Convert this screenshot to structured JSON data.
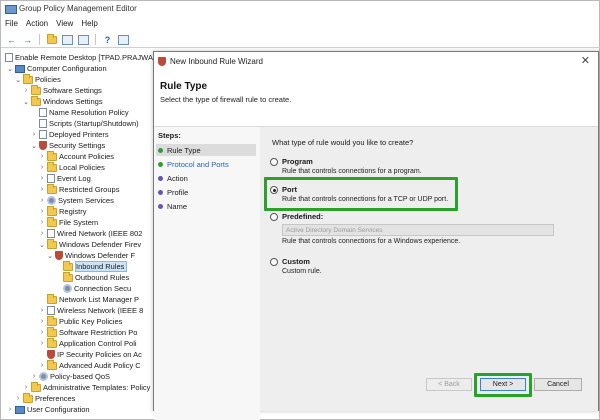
{
  "window": {
    "title": "Group Policy Management Editor"
  },
  "menu": [
    "File",
    "Action",
    "View",
    "Help"
  ],
  "tree": [
    {
      "label": "Enable Remote Desktop [TPAD.PRAJWALLO",
      "icon": "policy-document-icon"
    },
    {
      "label": "Computer Configuration",
      "icon": "computer-icon"
    },
    {
      "label": "Policies",
      "icon": "folder-icon"
    },
    {
      "label": "Software Settings",
      "icon": "folder-icon"
    },
    {
      "label": "Windows Settings",
      "icon": "folder-icon"
    },
    {
      "label": "Name Resolution Policy",
      "icon": "document-icon"
    },
    {
      "label": "Scripts (Startup/Shutdown)",
      "icon": "document-icon"
    },
    {
      "label": "Deployed Printers",
      "icon": "printer-icon"
    },
    {
      "label": "Security Settings",
      "icon": "security-icon"
    },
    {
      "label": "Account Policies",
      "icon": "folder-icon"
    },
    {
      "label": "Local Policies",
      "icon": "folder-icon"
    },
    {
      "label": "Event Log",
      "icon": "document-icon"
    },
    {
      "label": "Restricted Groups",
      "icon": "folder-icon"
    },
    {
      "label": "System Services",
      "icon": "gear-icon"
    },
    {
      "label": "Registry",
      "icon": "folder-icon"
    },
    {
      "label": "File System",
      "icon": "folder-icon"
    },
    {
      "label": "Wired Network (IEEE 802",
      "icon": "network-icon"
    },
    {
      "label": "Windows Defender Firev",
      "icon": "firewall-icon"
    },
    {
      "label": "Windows Defender F",
      "icon": "firewall-icon"
    },
    {
      "label": "Inbound Rules",
      "icon": "inbound-rules-icon"
    },
    {
      "label": "Outbound Rules",
      "icon": "outbound-rules-icon"
    },
    {
      "label": "Connection Secu",
      "icon": "connection-security-icon"
    },
    {
      "label": "Network List Manager P",
      "icon": "folder-icon"
    },
    {
      "label": "Wireless Network (IEEE 8",
      "icon": "wireless-icon"
    },
    {
      "label": "Public Key Policies",
      "icon": "folder-icon"
    },
    {
      "label": "Software Restriction Po",
      "icon": "folder-icon"
    },
    {
      "label": "Application Control Poli",
      "icon": "folder-icon"
    },
    {
      "label": "IP Security Policies on Ac",
      "icon": "ip-security-icon"
    },
    {
      "label": "Advanced Audit Policy C",
      "icon": "folder-icon"
    },
    {
      "label": "Policy-based QoS",
      "icon": "qos-icon"
    },
    {
      "label": "Administrative Templates: Policy",
      "icon": "folder-icon"
    },
    {
      "label": "Preferences",
      "icon": "folder-icon"
    },
    {
      "label": "User Configuration",
      "icon": "user-icon"
    }
  ],
  "dialog": {
    "title": "New Inbound Rule Wizard",
    "heading": "Rule Type",
    "subtitle": "Select the type of firewall rule to create.",
    "steps_title": "Steps:",
    "steps": [
      "Rule Type",
      "Protocol and Ports",
      "Action",
      "Profile",
      "Name"
    ],
    "question": "What type of rule would you like to create?",
    "options": [
      {
        "label": "Program",
        "desc": "Rule that controls connections for a program.",
        "selected": false
      },
      {
        "label": "Port",
        "desc": "Rule that controls connections for a TCP or UDP port.",
        "selected": true
      },
      {
        "label": "Predefined:",
        "desc": "Rule that controls connections for a Windows experience.",
        "selected": false
      },
      {
        "label": "Custom",
        "desc": "Custom rule.",
        "selected": false
      }
    ],
    "predefined_value": "Active Directory Domain Services",
    "buttons": {
      "back": "< Back",
      "next": "Next >",
      "cancel": "Cancel"
    }
  },
  "colors": {
    "highlight": "#2aa12a",
    "link": "#2b5fb4",
    "selection": "#cce4f7"
  }
}
